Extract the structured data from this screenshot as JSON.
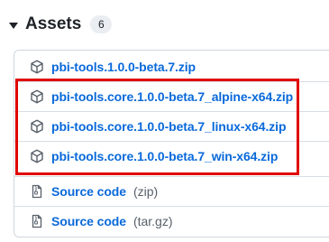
{
  "assets": {
    "title": "Assets",
    "count": "6",
    "items": [
      {
        "name": "pbi-tools.1.0.0-beta.7.zip",
        "icon": "package-icon"
      },
      {
        "name": "pbi-tools.core.1.0.0-beta.7_alpine-x64.zip",
        "icon": "package-icon"
      },
      {
        "name": "pbi-tools.core.1.0.0-beta.7_linux-x64.zip",
        "icon": "package-icon"
      },
      {
        "name": "pbi-tools.core.1.0.0-beta.7_win-x64.zip",
        "icon": "package-icon"
      },
      {
        "name": "Source code",
        "format": "(zip)",
        "icon": "file-zip-icon"
      },
      {
        "name": "Source code",
        "format": "(tar.gz)",
        "icon": "file-zip-icon"
      }
    ]
  },
  "colors": {
    "link": "#0969da",
    "highlight": "#e00000",
    "muted": "#57606a"
  }
}
